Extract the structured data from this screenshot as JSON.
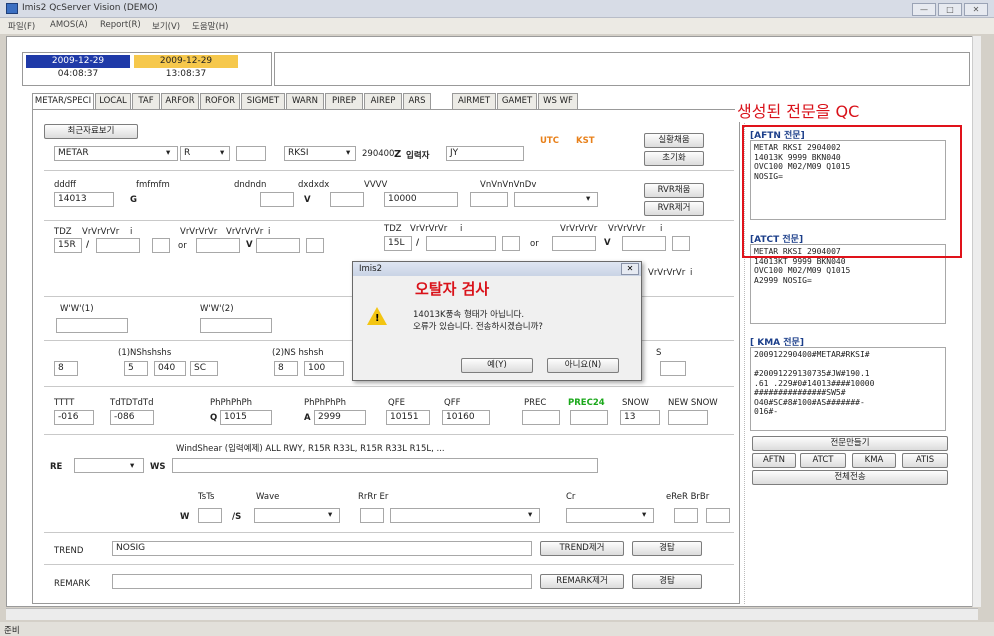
{
  "window": {
    "title": "Imis2 QcServer Vision (DEMO)",
    "btn_min": "—",
    "btn_max": "□",
    "btn_close": "✕"
  },
  "menu": [
    "파일(F)",
    "AMOS(A)",
    "Report(R)",
    "보기(V)",
    "도움말(H)"
  ],
  "dates": {
    "utc_date": "2009-12-29",
    "utc_time": "04:08:37",
    "kst_date": "2009-12-29",
    "kst_time": "13:08:37"
  },
  "tabs": [
    "METAR/SPECI",
    "LOCAL",
    "TAF",
    "ARFOR",
    "ROFOR",
    "SIGMET",
    "WARN",
    "PIREP",
    "AIREP",
    "ARS",
    "AIRMET",
    "GAMET",
    "WS WF"
  ],
  "form": {
    "recent_btn": "최근자료보기",
    "type": "METAR",
    "type_flag": "R",
    "station": "RKSI",
    "time": "290400",
    "z": "Z",
    "author_label": "입력자",
    "author": "JY",
    "utc": "UTC",
    "kst": "KST",
    "btn_real": "실황채움",
    "btn_init": "초기화",
    "wind_labels": [
      "dddff",
      "fmfmfm",
      "dndndn",
      "dxdxdx",
      "VVVV",
      "VnVnVnVnDv"
    ],
    "wind": "14013",
    "gust": "G",
    "v": "V",
    "vis": "10000",
    "btn_rvr_fill": "RVR채움",
    "btn_rvr_del": "RVR제거",
    "tdz_label": "TDZ",
    "rvr_label": "VrVrVrVr",
    "i_label": "i",
    "tdz1": "15R",
    "tdz2": "15L",
    "slash": "/",
    "or": "or",
    "ww1": "W'W'(1)",
    "ww2": "W'W'(2)",
    "cloud_label1": "(1)NShshshs",
    "cloud_label2": "(2)NS hshsh",
    "cloud": {
      "n1": "8",
      "ns1": "5",
      "h1": "040",
      "c1": "SC",
      "n2": "8",
      "h2": "100"
    },
    "temp_labels": [
      "TTTT",
      "TdTDTdTd",
      "PhPhPhPh",
      "PhPhPhPh",
      "QFE",
      "QFF",
      "PREC",
      "PREC24",
      "SNOW",
      "NEW SNOW"
    ],
    "tt": "-016",
    "td": "-086",
    "q": "Q",
    "qnh": "1015",
    "a": "A",
    "alt": "2999",
    "qfe": "10151",
    "qff": "10160",
    "snow": "13",
    "windshear_label": "WindShear (입력예제) ALL RWY, R15R R33L, R15R R33L R15L, ...",
    "re": "RE",
    "ws": "WS",
    "tsts": "TsTs",
    "wave": "Wave",
    "rrr": "RrRr Er",
    "cr": "Cr",
    "erer": "eReR BrBr",
    "w": "W",
    "s": "/S",
    "trend_label": "TREND",
    "trend": "NOSIG",
    "btn_trend_del": "TREND제거",
    "btn_trend_ok": "경탑",
    "remark_label": "REMARK",
    "btn_remark_del": "REMARK제거",
    "btn_remark_ok": "경탑"
  },
  "side": {
    "aftn_title": "[AFTN 전문]",
    "aftn_text": "METAR RKSI 2904002\n14013K 9999 BKN040\nOVC100 M02/M09 Q1015\nNOSIG=",
    "atct_title": "[ATCT 전문]",
    "atct_text": "METAR RKSI 2904007\n14013KT 9999 BKN040\nOVC100 M02/M09 Q1015\nA2999 NOSIG=",
    "kma_title": "[ KMA 전문]",
    "kma_text": "200912290400#METAR#RKSI#\n\n#20091229130735#JW#190.1\n.61 .229#0#14013####10000\n###############SW5#\nO40#SC#8#100#AS#######-\n016#-",
    "btn_make": "전문만들기",
    "btn_aftn": "AFTN",
    "btn_atct": "ATCT",
    "btn_kma": "KMA",
    "btn_atis": "ATIS",
    "btn_all": "전체전송"
  },
  "annotation": "생성된 전문을 QC",
  "dialog": {
    "title": "Imis2",
    "heading": "오탈자 검사",
    "msg1": "14013K풍속 형태가 아닙니다.",
    "msg2": "오류가 있습니다. 전송하시겠습니까?",
    "yes": "예(Y)",
    "no": "아니요(N)",
    "close": "✕"
  },
  "status": "준비"
}
